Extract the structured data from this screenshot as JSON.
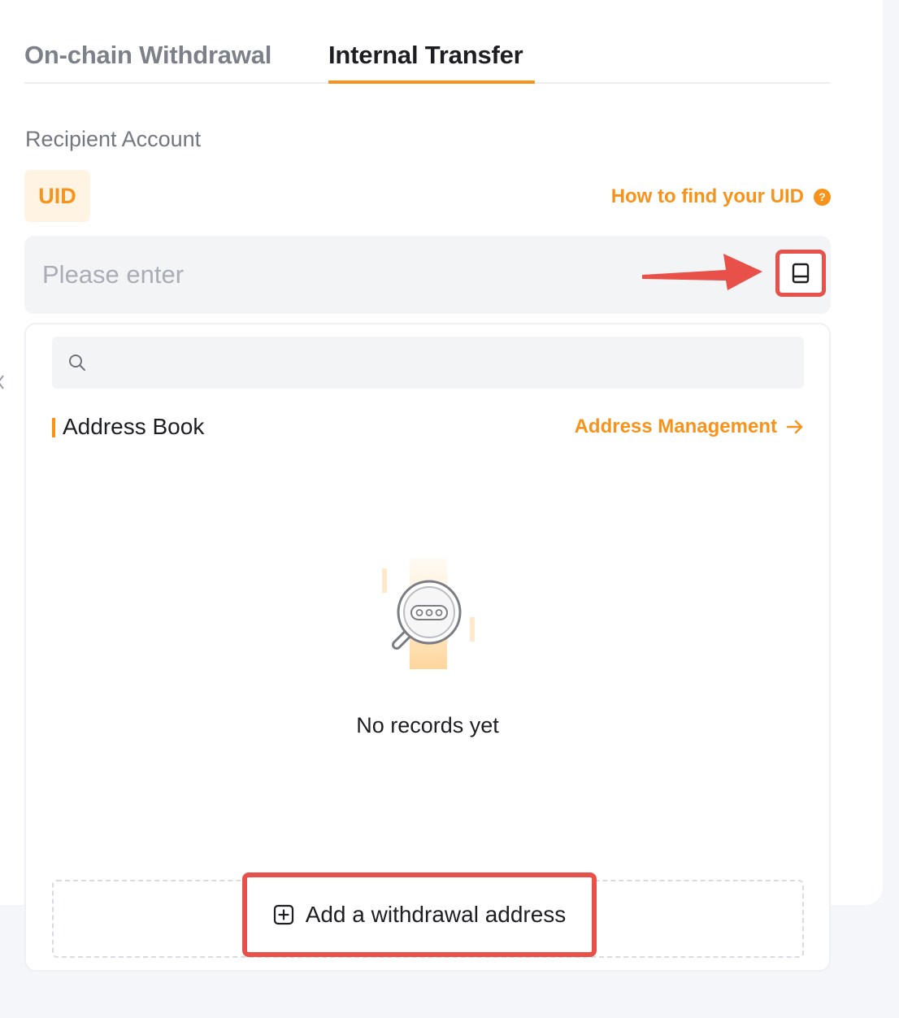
{
  "tabs": [
    {
      "label": "On-chain Withdrawal",
      "active": false
    },
    {
      "label": "Internal Transfer",
      "active": true
    }
  ],
  "recipient": {
    "label": "Recipient Account",
    "chip": "UID",
    "help_link": "How to find your UID",
    "help_icon": "question-circle-icon",
    "input_placeholder": "Please enter",
    "input_value": "",
    "address_book_icon": "address-book-icon"
  },
  "dropdown": {
    "search_placeholder": "",
    "search_icon": "search-icon",
    "section_title": "Address Book",
    "manage_link": "Address Management",
    "manage_icon": "arrow-right-icon",
    "empty_text": "No records yet",
    "add_button": "Add a withdrawal address",
    "add_icon": "plus-square-icon"
  },
  "colors": {
    "accent": "#f7931a",
    "highlight": "#e8504a",
    "text": "#1c1e22",
    "muted": "#7c8088"
  }
}
